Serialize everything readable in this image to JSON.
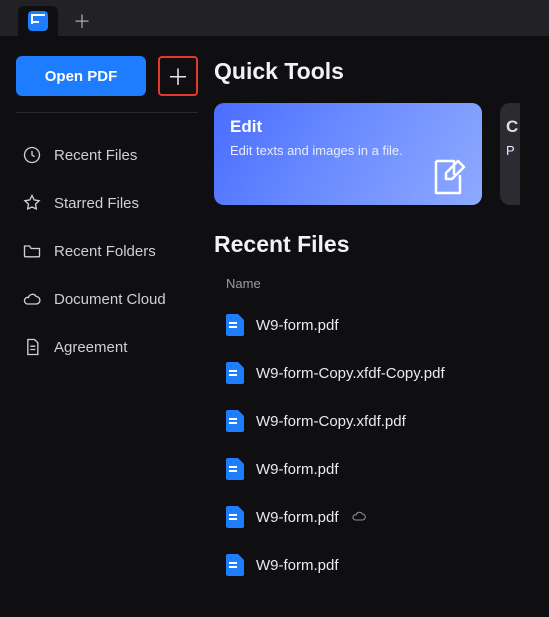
{
  "sidebar": {
    "open_label": "Open PDF",
    "items": [
      {
        "label": "Recent Files",
        "icon": "clock-icon"
      },
      {
        "label": "Starred Files",
        "icon": "star-icon"
      },
      {
        "label": "Recent Folders",
        "icon": "folder-icon"
      },
      {
        "label": "Document Cloud",
        "icon": "cloud-icon"
      },
      {
        "label": "Agreement",
        "icon": "document-icon"
      }
    ]
  },
  "quick_tools": {
    "title": "Quick Tools",
    "cards": [
      {
        "title": "Edit",
        "subtitle": "Edit texts and images in a file."
      },
      {
        "title": "C",
        "subtitle": "P"
      }
    ]
  },
  "recent": {
    "title": "Recent Files",
    "column": "Name",
    "files": [
      {
        "name": "W9-form.pdf",
        "cloud": false
      },
      {
        "name": "W9-form-Copy.xfdf-Copy.pdf",
        "cloud": false
      },
      {
        "name": "W9-form-Copy.xfdf.pdf",
        "cloud": false
      },
      {
        "name": "W9-form.pdf",
        "cloud": false
      },
      {
        "name": "W9-form.pdf",
        "cloud": true
      },
      {
        "name": "W9-form.pdf",
        "cloud": false
      }
    ]
  }
}
